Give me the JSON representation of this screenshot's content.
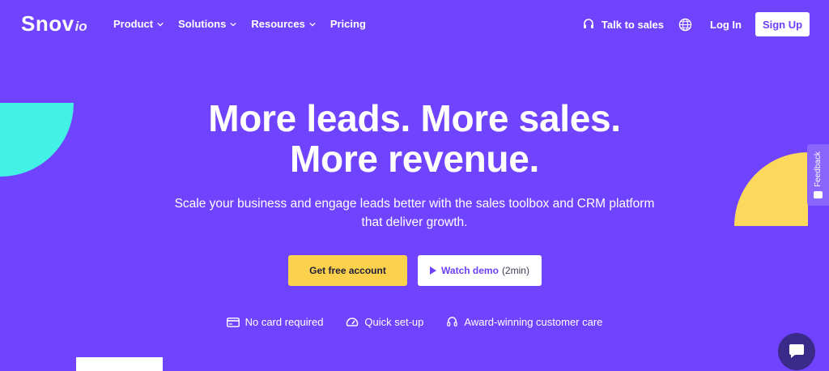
{
  "brand": {
    "name": "Snov",
    "suffix": "io"
  },
  "nav": {
    "items": [
      {
        "label": "Product",
        "has_dropdown": true
      },
      {
        "label": "Solutions",
        "has_dropdown": true
      },
      {
        "label": "Resources",
        "has_dropdown": true
      },
      {
        "label": "Pricing",
        "has_dropdown": false
      }
    ]
  },
  "header_right": {
    "talk_to_sales": "Talk to sales",
    "login": "Log In",
    "signup": "Sign Up"
  },
  "hero": {
    "title_line1": "More leads. More sales.",
    "title_line2": "More revenue.",
    "subtitle_line1": "Scale your business and engage leads better with the sales toolbox and CRM platform",
    "subtitle_line2": "that deliver growth.",
    "cta_primary": "Get free account",
    "cta_demo": "Watch demo",
    "cta_demo_duration": "(2min)"
  },
  "features": [
    {
      "icon": "credit-card-icon",
      "label": "No card required"
    },
    {
      "icon": "speedometer-icon",
      "label": "Quick set-up"
    },
    {
      "icon": "headset-icon",
      "label": "Award-winning customer care"
    }
  ],
  "feedback": {
    "label": "Feedback"
  },
  "colors": {
    "background": "#7043ff",
    "accent_teal": "#43f2e4",
    "accent_yellow": "#fcd95c",
    "cta_yellow": "#fcd14c",
    "chat": "#3a2a8a"
  }
}
